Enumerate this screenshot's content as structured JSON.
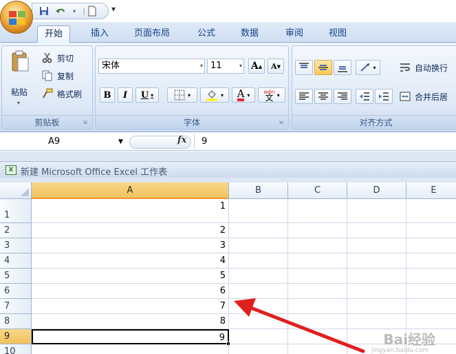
{
  "quick_access": {
    "save_icon": "save-icon",
    "undo_icon": "undo-icon",
    "new_icon": "new-document-icon",
    "customize_icon": "customize-icon"
  },
  "tabs": [
    {
      "label": "开始",
      "active": true
    },
    {
      "label": "插入"
    },
    {
      "label": "页面布局"
    },
    {
      "label": "公式"
    },
    {
      "label": "数据"
    },
    {
      "label": "审阅"
    },
    {
      "label": "视图"
    }
  ],
  "ribbon": {
    "clipboard": {
      "paste": "粘贴",
      "cut": "剪切",
      "copy": "复制",
      "format_painter": "格式刷",
      "group_label": "剪贴板"
    },
    "font": {
      "font_name": "宋体",
      "font_size": "11",
      "grow": "A",
      "shrink": "A",
      "bold": "B",
      "italic": "I",
      "underline": "U",
      "font_color": "A",
      "phonetic": "wén",
      "group_label": "字体"
    },
    "alignment": {
      "wrap_text": "自动换行",
      "merge_center": "合并后居",
      "group_label": "对齐方式"
    }
  },
  "formula_bar": {
    "name_box": "A9",
    "fx": "fx",
    "value": "9"
  },
  "workbook": {
    "title": "新建 Microsoft Office Excel 工作表",
    "columns": [
      "A",
      "B",
      "C",
      "D",
      "E"
    ],
    "selected_column": "A",
    "rows": [
      {
        "num": "1",
        "a": "1"
      },
      {
        "num": "2",
        "a": "2"
      },
      {
        "num": "3",
        "a": "3"
      },
      {
        "num": "4",
        "a": "4"
      },
      {
        "num": "5",
        "a": "5"
      },
      {
        "num": "6",
        "a": "6"
      },
      {
        "num": "7",
        "a": "7"
      },
      {
        "num": "8",
        "a": "8"
      },
      {
        "num": "9",
        "a": "9"
      },
      {
        "num": "10",
        "a": ""
      }
    ],
    "selected_row": "9"
  },
  "watermark": {
    "text": "Bai经验",
    "sub": "jingyan.baidu.com"
  },
  "colors": {
    "annotation_arrow": "#e02020",
    "selection_header": "#f1c15f"
  }
}
